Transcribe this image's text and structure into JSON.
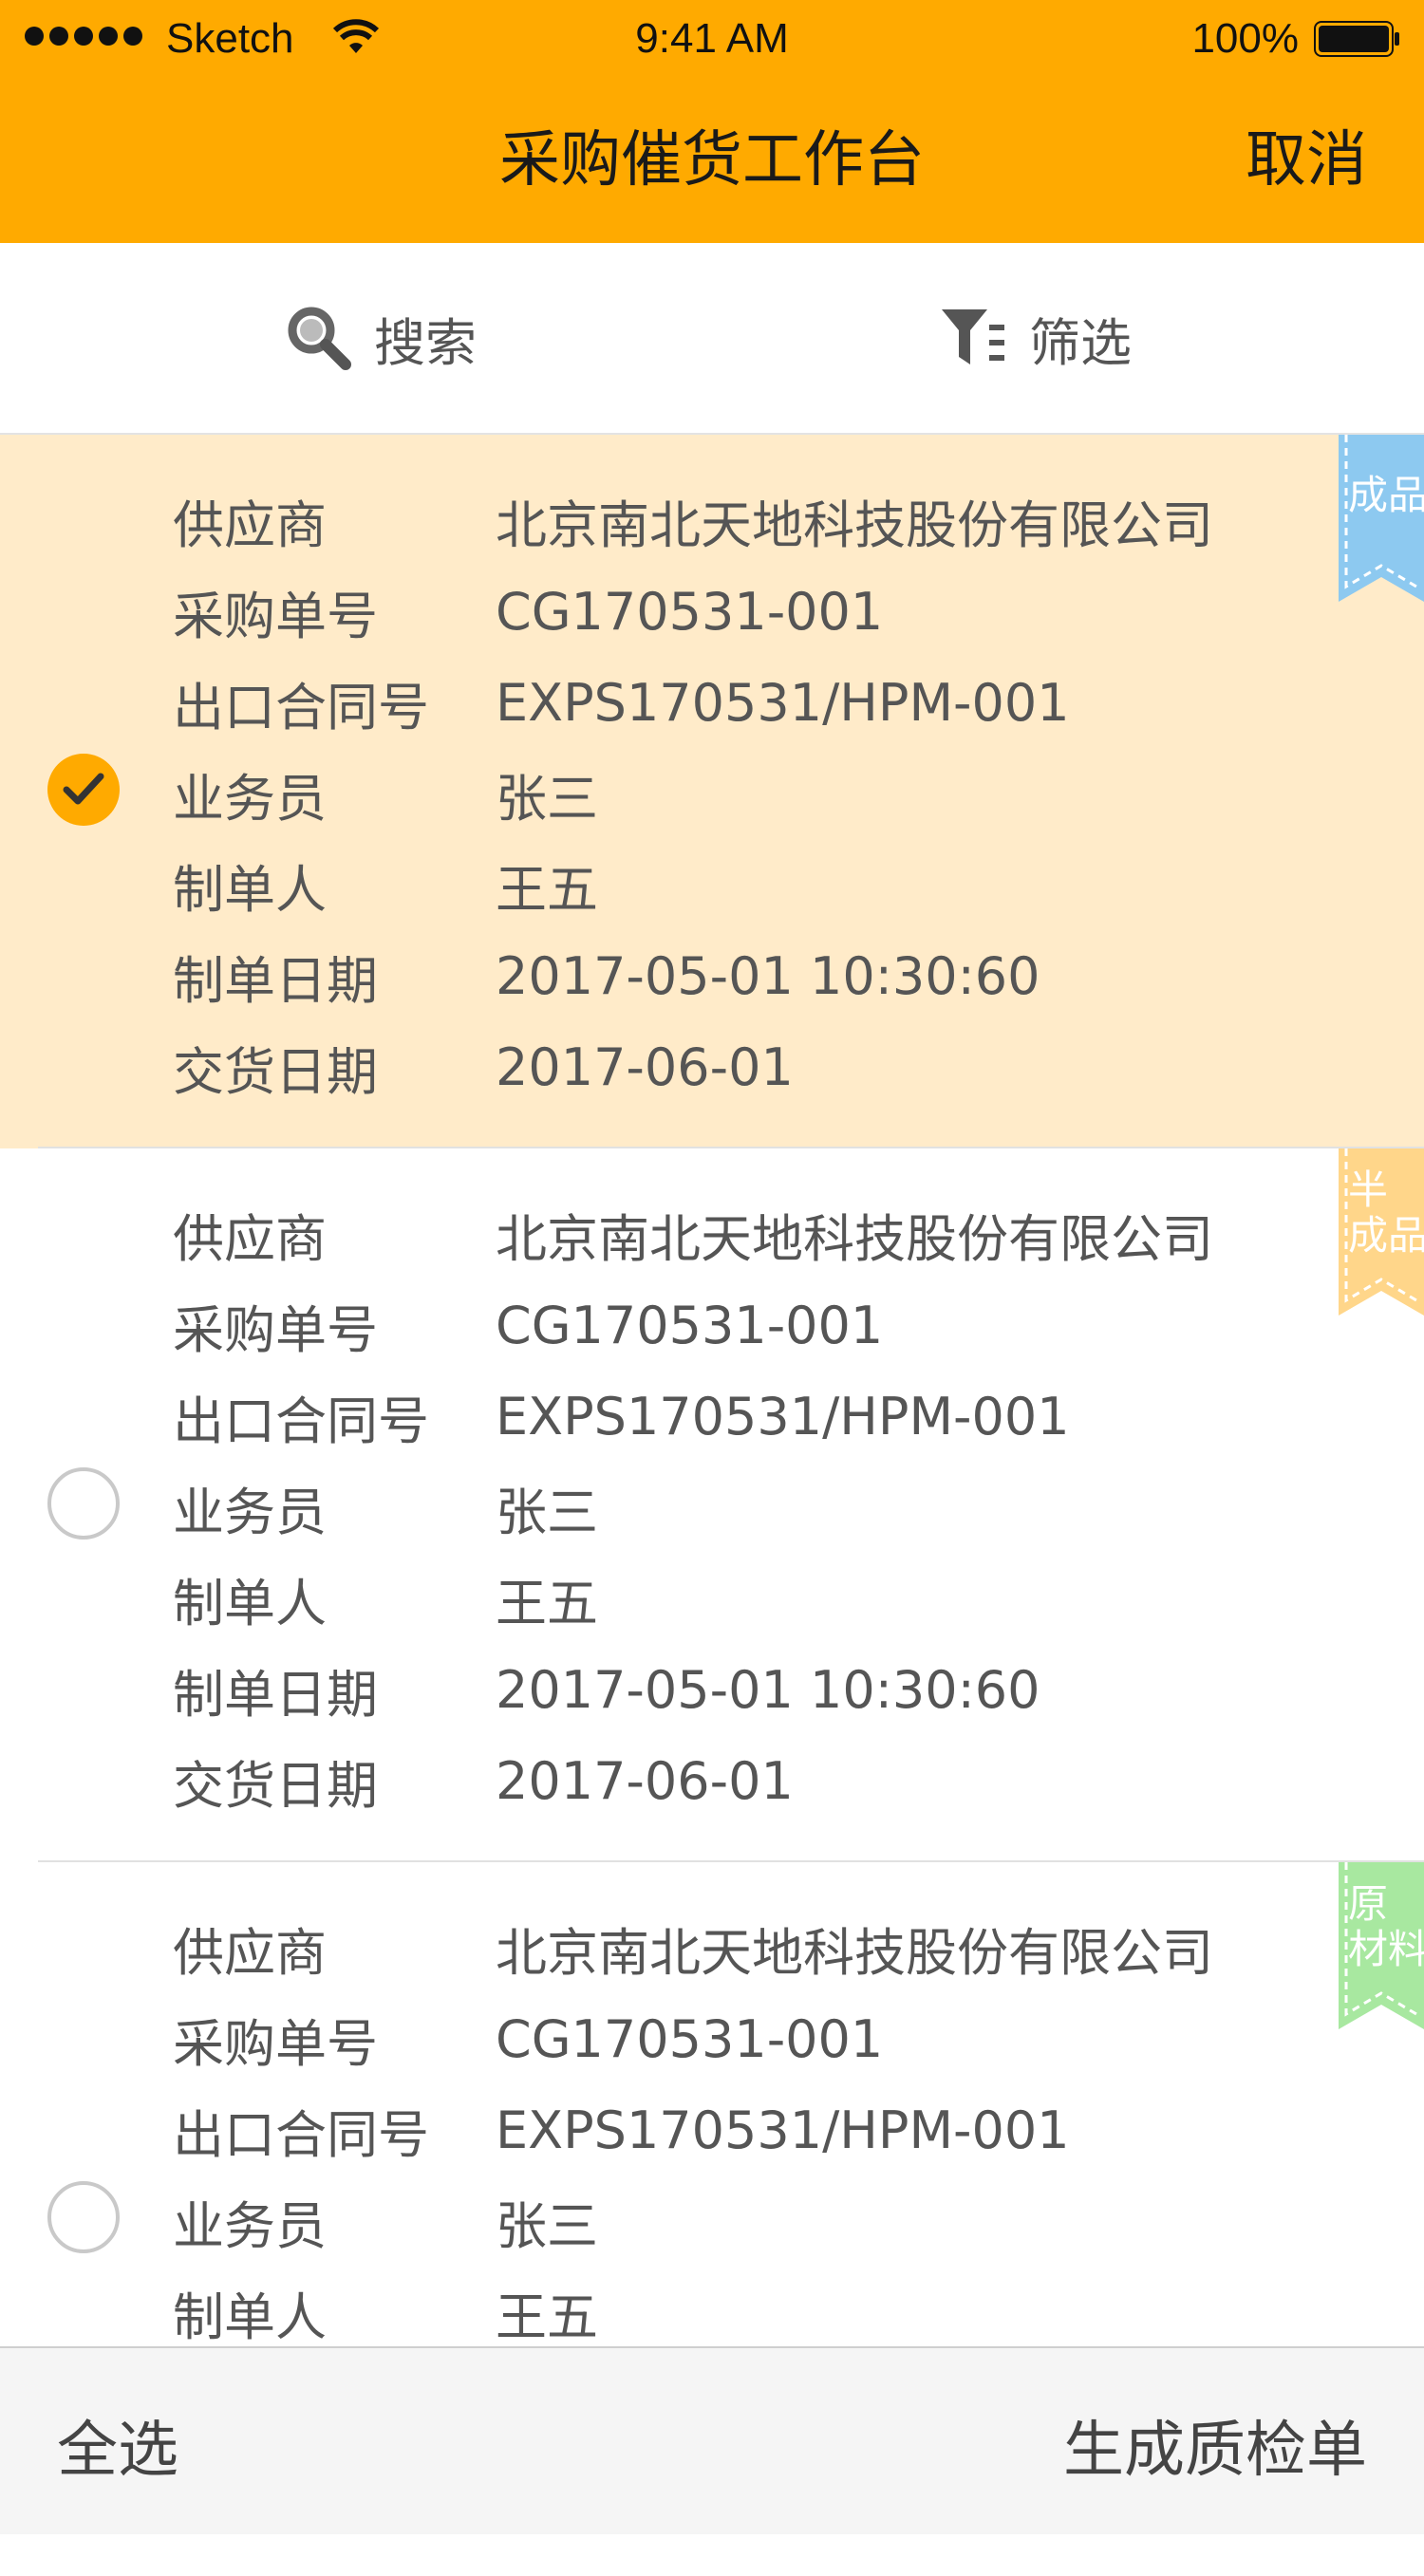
{
  "status_bar": {
    "carrier": "Sketch",
    "time": "9:41 AM",
    "battery": "100%"
  },
  "nav": {
    "title": "采购催货工作台",
    "cancel": "取消"
  },
  "toolbar": {
    "search": "搜索",
    "filter": "筛选"
  },
  "labels": {
    "supplier": "供应商",
    "order_no": "采购单号",
    "contract_no": "出口合同号",
    "salesman": "业务员",
    "creator": "制单人",
    "create_date": "制单日期",
    "delivery_date": "交货日期"
  },
  "orders": [
    {
      "selected": true,
      "tag": "成品",
      "tag_color": "#8DC9F0",
      "supplier": "北京南北天地科技股份有限公司",
      "order_no": "CG170531-001",
      "contract_no": "EXPS170531/HPM-001",
      "salesman": "张三",
      "creator": "王五",
      "create_date": "2017-05-01 10:30:60",
      "delivery_date": "2017-06-01"
    },
    {
      "selected": false,
      "tag": "半\n成品",
      "tag_color": "#FFD68A",
      "supplier": "北京南北天地科技股份有限公司",
      "order_no": "CG170531-001",
      "contract_no": "EXPS170531/HPM-001",
      "salesman": "张三",
      "creator": "王五",
      "create_date": "2017-05-01 10:30:60",
      "delivery_date": "2017-06-01"
    },
    {
      "selected": false,
      "tag": "原\n材料",
      "tag_color": "#A8E8A0",
      "supplier": "北京南北天地科技股份有限公司",
      "order_no": "CG170531-001",
      "contract_no": "EXPS170531/HPM-001",
      "salesman": "张三",
      "creator": "王五"
    }
  ],
  "bottom_bar": {
    "select_all": "全选",
    "generate": "生成质检单"
  },
  "colors": {
    "accent": "#FFAA00",
    "selected_bg": "#FFEBC9"
  }
}
